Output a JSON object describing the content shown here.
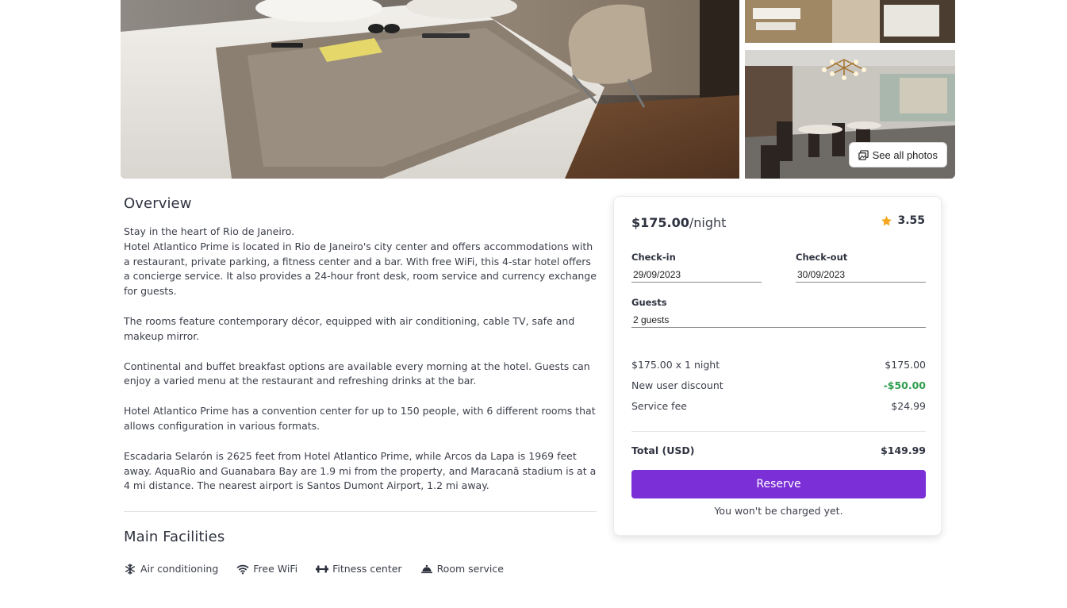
{
  "gallery": {
    "see_all_label": "See all photos"
  },
  "overview": {
    "title": "Overview",
    "paragraphs": [
      "Stay in the heart of Rio de Janeiro.",
      "Hotel Atlantico Prime is located in Rio de Janeiro's city center and offers accommodations with a restaurant, private parking, a fitness center and a bar. With free WiFi, this 4-star hotel offers a concierge service. It also provides a 24-hour front desk, room service and currency exchange for guests.",
      "The rooms feature contemporary décor, equipped with air conditioning, cable TV, safe and makeup mirror.",
      "Continental and buffet breakfast options are available every morning at the hotel. Guests can enjoy a varied menu at the restaurant and refreshing drinks at the bar.",
      "Hotel Atlantico Prime has a convention center for up to 150 people, with 6 different rooms that allows configuration in various formats.",
      "Escadaria Selarón is 2625 feet from Hotel Atlantico Prime, while Arcos da Lapa is 1969 feet away. AquaRio and Guanabara Bay are 1.9 mi from the property, and Maracanã stadium is at a 4 mi distance. The nearest airport is Santos Dumont Airport, 1.2 mi away."
    ]
  },
  "facilities": {
    "title": "Main Facilities",
    "items": [
      {
        "label": "Air conditioning",
        "icon": "snowflake-icon"
      },
      {
        "label": "Free WiFi",
        "icon": "wifi-icon"
      },
      {
        "label": "Fitness center",
        "icon": "dumbbell-icon"
      },
      {
        "label": "Room service",
        "icon": "cloche-icon"
      }
    ]
  },
  "booking": {
    "price": "$175.00",
    "per_night": "/night",
    "rating": "3.55",
    "checkin_label": "Check-in",
    "checkin_value": "29/09/2023",
    "checkout_label": "Check-out",
    "checkout_value": "30/09/2023",
    "guests_label": "Guests",
    "guests_value": "2 guests",
    "line_items": [
      {
        "label": "$175.00 x 1 night",
        "value": "$175.00"
      },
      {
        "label": "New user discount",
        "value": "-$50.00"
      },
      {
        "label": "Service fee",
        "value": "$24.99"
      }
    ],
    "total_label": "Total (USD)",
    "total_value": "$149.99",
    "reserve_label": "Reserve",
    "note": "You won't be charged yet."
  },
  "colors": {
    "accent": "#7b2fd6",
    "discount": "#2e9e4e",
    "star": "#f4a51c"
  }
}
